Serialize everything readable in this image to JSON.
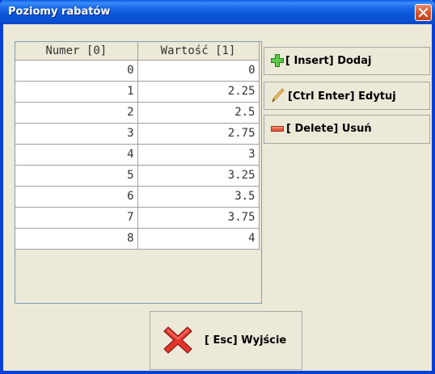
{
  "window": {
    "title": "Poziomy rabatów"
  },
  "table": {
    "columns": [
      "Numer [0]",
      "Wartość [1]"
    ],
    "rows": [
      {
        "numer": "0",
        "wartosc": "0"
      },
      {
        "numer": "1",
        "wartosc": "2.25"
      },
      {
        "numer": "2",
        "wartosc": "2.5"
      },
      {
        "numer": "3",
        "wartosc": "2.75"
      },
      {
        "numer": "4",
        "wartosc": "3"
      },
      {
        "numer": "5",
        "wartosc": "3.25"
      },
      {
        "numer": "6",
        "wartosc": "3.5"
      },
      {
        "numer": "7",
        "wartosc": "3.75"
      },
      {
        "numer": "8",
        "wartosc": "4"
      }
    ]
  },
  "actions": {
    "add_label": "[ Insert] Dodaj",
    "add_icon": "plus-icon",
    "edit_label": "[Ctrl Enter] Edytuj",
    "edit_icon": "pencil-icon",
    "delete_label": "[ Delete] Usuń",
    "delete_icon": "minus-icon",
    "exit_label": "[ Esc] Wyjście",
    "exit_icon": "red-x-icon"
  },
  "colors": {
    "titlebar": "#0a4fd0",
    "window_bg": "#ece9d8",
    "add_icon": "#3aa52a",
    "delete_icon": "#e0442c",
    "exit_icon": "#e0302a"
  }
}
